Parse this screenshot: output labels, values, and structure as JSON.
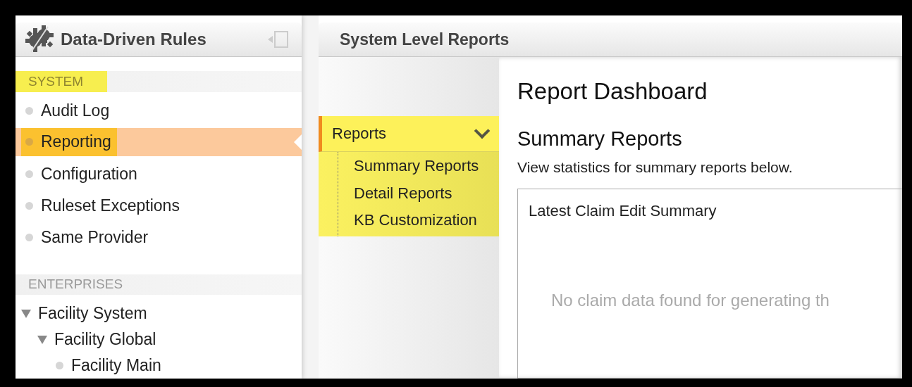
{
  "sidebar": {
    "title": "Data-Driven Rules",
    "sections": [
      {
        "label": "SYSTEM",
        "highlighted": true,
        "items": [
          {
            "label": "Audit Log",
            "selected": false,
            "highlighted": false
          },
          {
            "label": "Reporting",
            "selected": true,
            "highlighted": true
          },
          {
            "label": "Configuration",
            "selected": false,
            "highlighted": false
          },
          {
            "label": "Ruleset Exceptions",
            "selected": false,
            "highlighted": false
          },
          {
            "label": "Same Provider",
            "selected": false,
            "highlighted": false
          }
        ]
      },
      {
        "label": "ENTERPRISES",
        "highlighted": false,
        "tree": [
          {
            "label": "Facility System",
            "expanded": true,
            "children": [
              {
                "label": "Facility Global",
                "expanded": true,
                "children": [
                  {
                    "label": "Facility Main"
                  }
                ]
              }
            ]
          }
        ]
      }
    ]
  },
  "main": {
    "title": "System Level Reports",
    "submenu": {
      "label": "Reports",
      "expanded": true,
      "highlighted": true,
      "items": [
        {
          "label": "Summary Reports",
          "selected": false
        },
        {
          "label": "Detail Reports",
          "selected": false
        },
        {
          "label": "KB Customization",
          "selected": false
        }
      ]
    },
    "content": {
      "heading": "Report Dashboard",
      "subheading": "Summary Reports",
      "description": "View statistics for summary reports below.",
      "card": {
        "title": "Latest Claim Edit Summary",
        "message": "No claim data found for generating th"
      }
    }
  }
}
